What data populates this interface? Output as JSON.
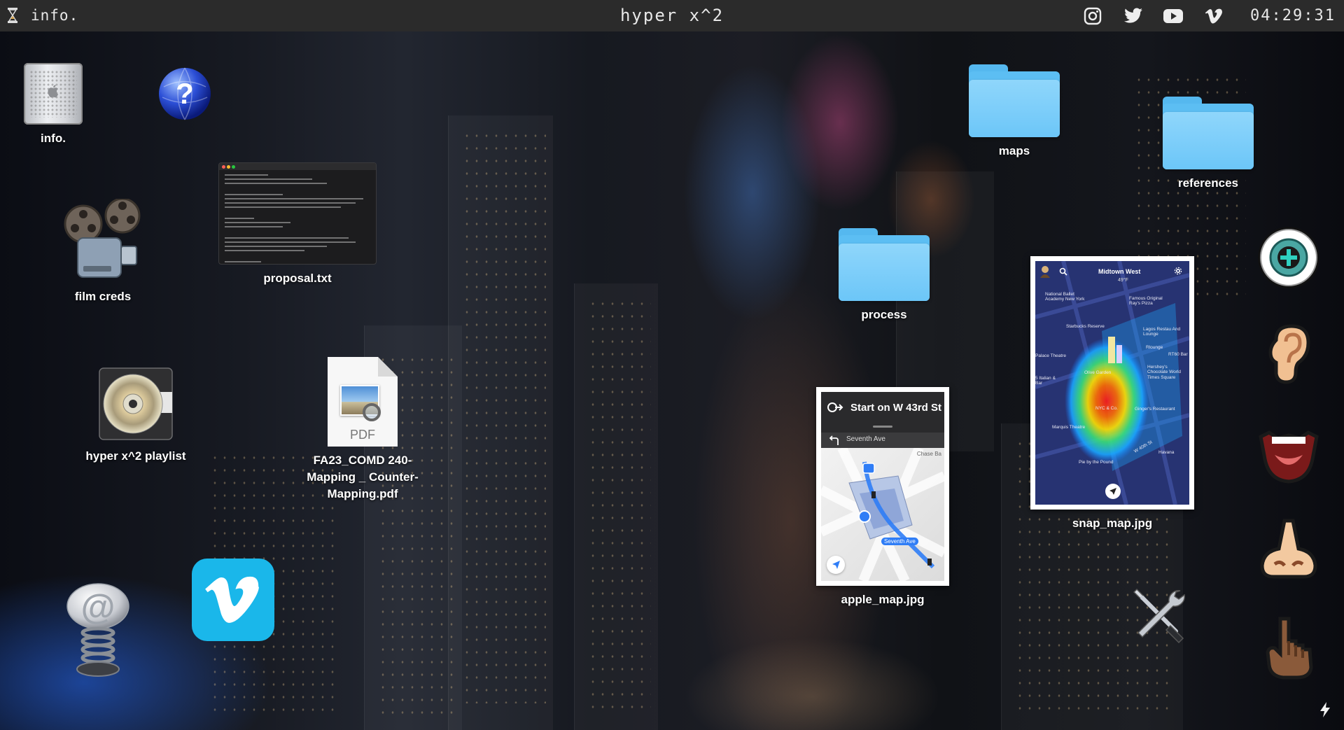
{
  "menubar": {
    "app_name": "info.",
    "title": "hyper x^2",
    "clock": "04:29:31",
    "social": [
      "instagram-icon",
      "twitter-icon",
      "youtube-icon",
      "vimeo-icon"
    ]
  },
  "desktop": {
    "info": {
      "label": "info."
    },
    "help": {
      "label": ""
    },
    "film_creds": {
      "label": "film creds"
    },
    "proposal": {
      "label": "proposal.txt"
    },
    "playlist": {
      "label": "hyper x^2 playlist"
    },
    "pdf": {
      "label": "FA23_COMD 240-Mapping _ Counter-Mapping.pdf",
      "badge": "PDF"
    },
    "maps": {
      "label": "maps"
    },
    "references": {
      "label": "references"
    },
    "process": {
      "label": "process"
    },
    "apple_map": {
      "label": "apple_map.jpg",
      "header": "Start on W 43rd St",
      "sub": "Seventh Ave",
      "chase": "Chase Ba",
      "route_label": "Seventh Ave"
    },
    "snap_map": {
      "label": "snap_map.jpg",
      "location": "Midtown West",
      "temp": "49°F",
      "places": [
        "National Ballet Academy New York",
        "Famous Original Ray's Pizza",
        "Starbucks Reserve",
        "Lagos Restau And Lounge",
        "Rlounge",
        "Palace Theatre",
        "RT60 Bar",
        "Olive Garden",
        "Hershey's Chocolate World Times Square",
        "5 Italian & Bar",
        "NYC & Co.",
        "Ginger's Restaurant",
        "Marquis Theatre",
        "Havana",
        "Pie by the Pound",
        "W 40th St"
      ]
    }
  },
  "colors": {
    "menubar_bg": "#2b2b2b",
    "folder_blue": "#6cc6f8",
    "vimeo_blue": "#1ab7ea"
  }
}
